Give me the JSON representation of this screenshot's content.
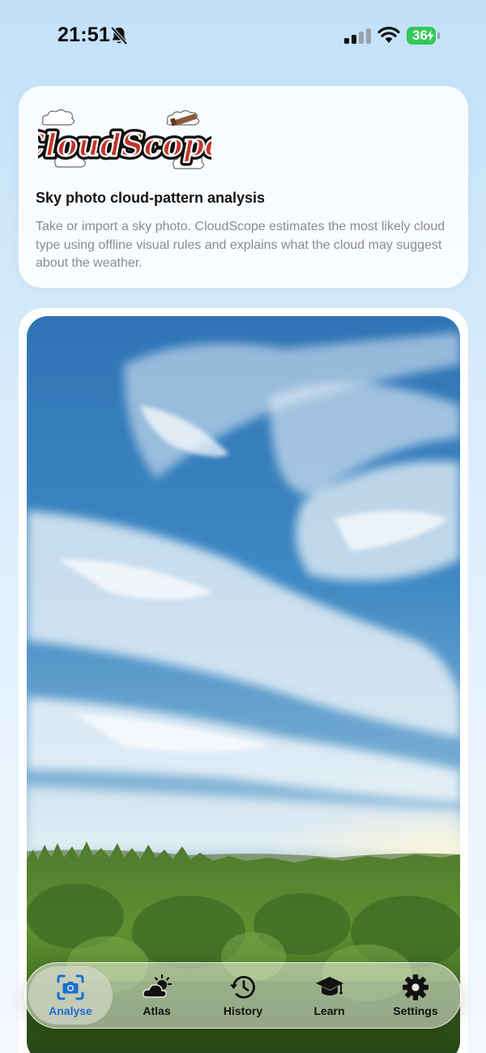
{
  "status_bar": {
    "time": "21:51",
    "battery": "36",
    "icons": [
      "bell-slash-icon",
      "cellular-signal-icon",
      "wifi-icon",
      "battery-charging-icon"
    ]
  },
  "header": {
    "logo_text": "CloudScope",
    "title": "Sky photo cloud-pattern analysis",
    "description": "Take or import a sky photo. CloudScope estimates the most likely cloud type using offline visual rules and explains what the cloud may suggest about the weather."
  },
  "tabs": [
    {
      "label": "Analyse",
      "icon": "camera-viewfinder-icon",
      "active": true
    },
    {
      "label": "Atlas",
      "icon": "cloud-sun-icon",
      "active": false
    },
    {
      "label": "History",
      "icon": "clock-history-icon",
      "active": false
    },
    {
      "label": "Learn",
      "icon": "graduation-cap-icon",
      "active": false
    },
    {
      "label": "Settings",
      "icon": "gear-icon",
      "active": false
    }
  ],
  "colors": {
    "accent": "#1a6fd8",
    "battery": "#34c759",
    "background_top": "#c2e1f9",
    "muted_text": "#8a8c90"
  }
}
